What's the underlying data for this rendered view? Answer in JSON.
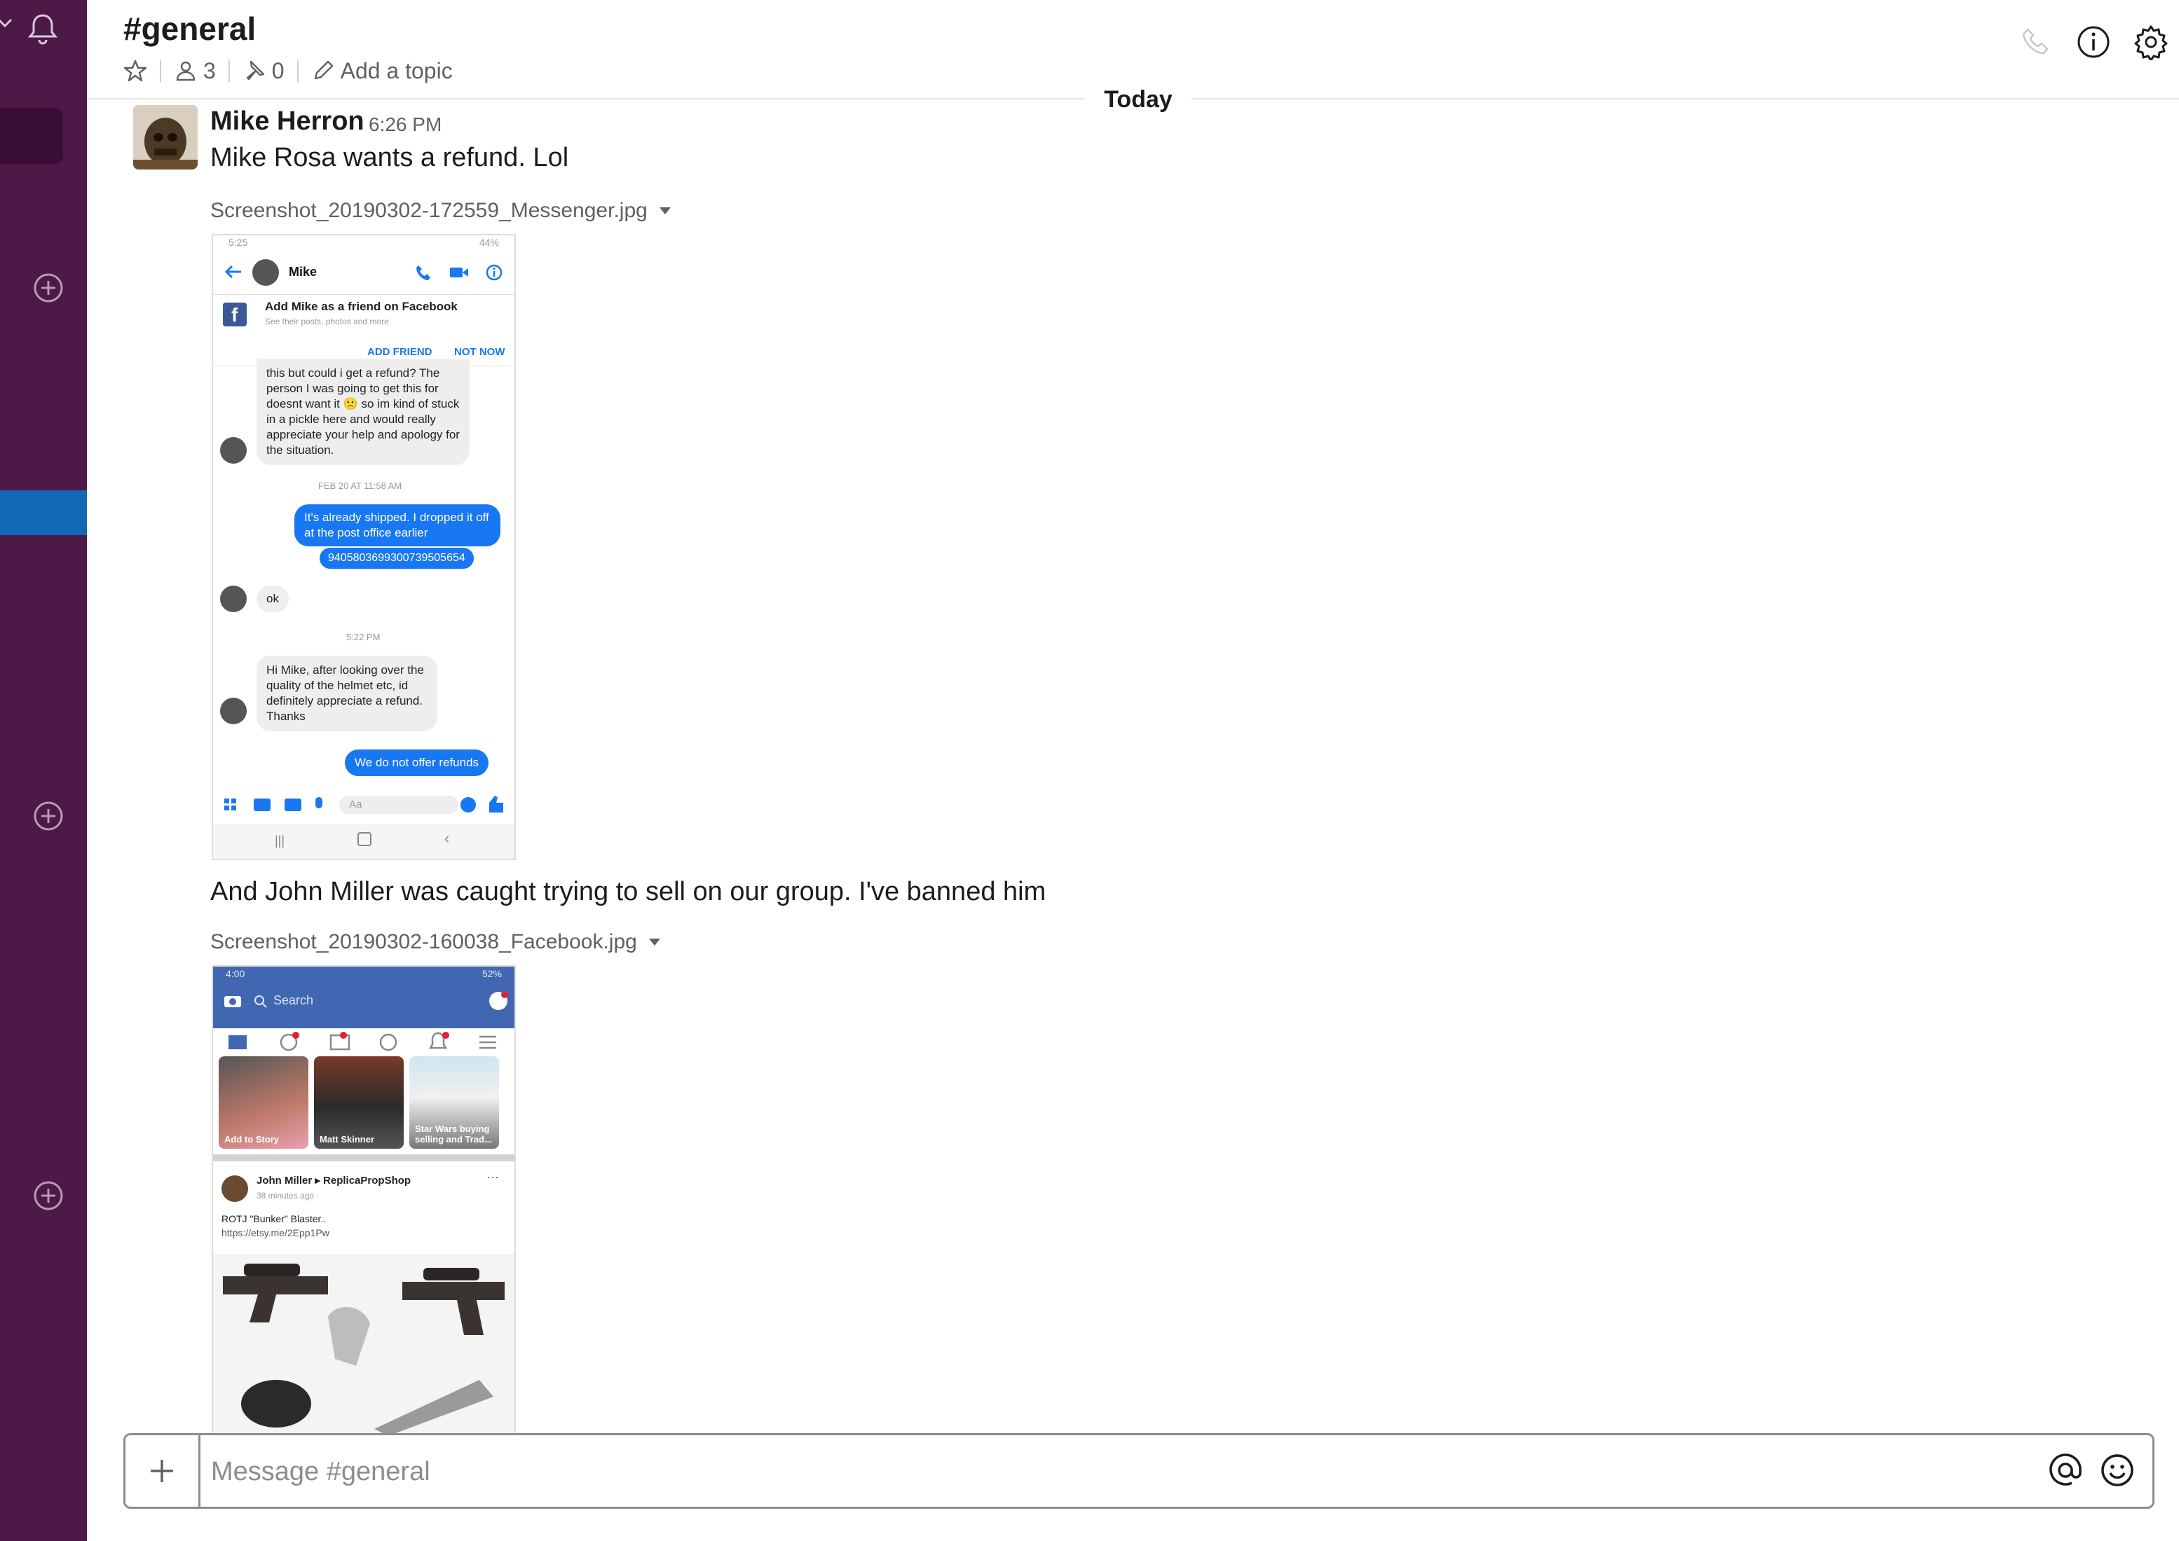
{
  "channel": {
    "title": "#general",
    "members_count": "3",
    "pinned_count": "0",
    "topic_placeholder": "Add a topic"
  },
  "divider": {
    "label": "Today"
  },
  "message": {
    "sender": "Mike Herron",
    "time": "6:26 PM",
    "text1": "Mike Rosa wants a refund. Lol",
    "file1": "Screenshot_20190302-172559_Messenger.jpg",
    "text2": "And John Miller was caught trying to sell on our group. I've banned him",
    "file2": "Screenshot_20190302-160038_Facebook.jpg"
  },
  "messenger_shot": {
    "status_time": "5:25",
    "status_right": "44%",
    "contact": "Mike",
    "add_friend_title": "Add Mike as a friend on Facebook",
    "add_friend_sub": "See their posts, photos and more",
    "add_friend_btn": "ADD FRIEND",
    "not_now_btn": "NOT NOW",
    "bubble_refund_request": "this but could i get a refund? The person I was going to get this for doesnt want it 🙁 so im kind of stuck in a pickle here and would really appreciate your help and apology for the situation.",
    "timestamp1": "FEB 20 AT 11:58 AM",
    "bubble_shipped": "It's already shipped. I dropped it off at the post office earlier",
    "bubble_tracking": "9405803699300739505654",
    "bubble_ok": "ok",
    "timestamp2": "5:22 PM",
    "bubble_helmet": "Hi Mike, after looking over the quality of the helmet etc, id definitely appreciate a refund. Thanks",
    "bubble_no_refunds": "We do not offer refunds",
    "input_placeholder": "Aa"
  },
  "facebook_shot": {
    "status_time": "4:00",
    "status_right": "52%",
    "search_placeholder": "Search",
    "stories": [
      "Add to Story",
      "Matt Skinner",
      "Star Wars buying selling and Trad..."
    ],
    "post_author": "John Miller ▸ ReplicaPropShop",
    "post_time": "38 minutes ago · ",
    "post_text": "ROTJ \"Bunker\" Blaster..",
    "post_link": "https://etsy.me/2Epp1Pw"
  },
  "composer": {
    "placeholder": "Message #general"
  }
}
